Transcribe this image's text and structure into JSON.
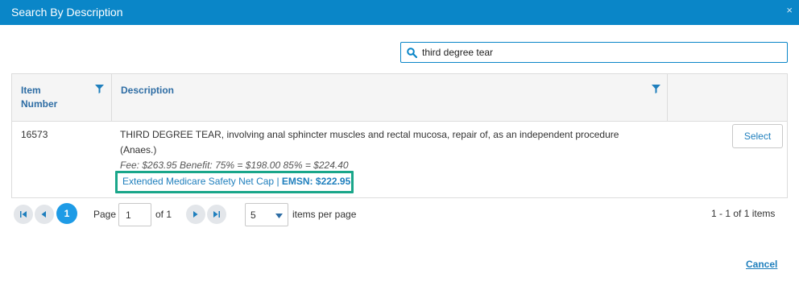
{
  "dialog": {
    "title": "Search By Description",
    "close_glyph": "×"
  },
  "search": {
    "value": "third degree tear",
    "icon": "search-icon"
  },
  "grid": {
    "columns": [
      {
        "label": "Item Number"
      },
      {
        "label": "Description"
      }
    ],
    "rows": [
      {
        "item_number": "16573",
        "description": "THIRD DEGREE TEAR, involving anal sphincter muscles and rectal mucosa, repair of, as an independent procedure",
        "anaes": "(Anaes.)",
        "fee": "Fee: $263.95 Benefit: 75% = $198.00 85% = $224.40",
        "emsn_link": "Extended Medicare Safety Net Cap | ",
        "emsn_value": "EMSN: $222.95",
        "action_label": "Select"
      }
    ]
  },
  "pager": {
    "current_page": "1",
    "page_label": "Page",
    "page_input": "1",
    "of_label": "of 1",
    "page_size": "5",
    "items_per_page_label": "items per page",
    "summary": "1 - 1 of 1 items"
  },
  "footer": {
    "cancel_label": "Cancel"
  },
  "colors": {
    "header": "#0a86c8",
    "accent": "#1e9be6",
    "highlight_box": "#1aa68a",
    "link": "#1f7fbd"
  }
}
